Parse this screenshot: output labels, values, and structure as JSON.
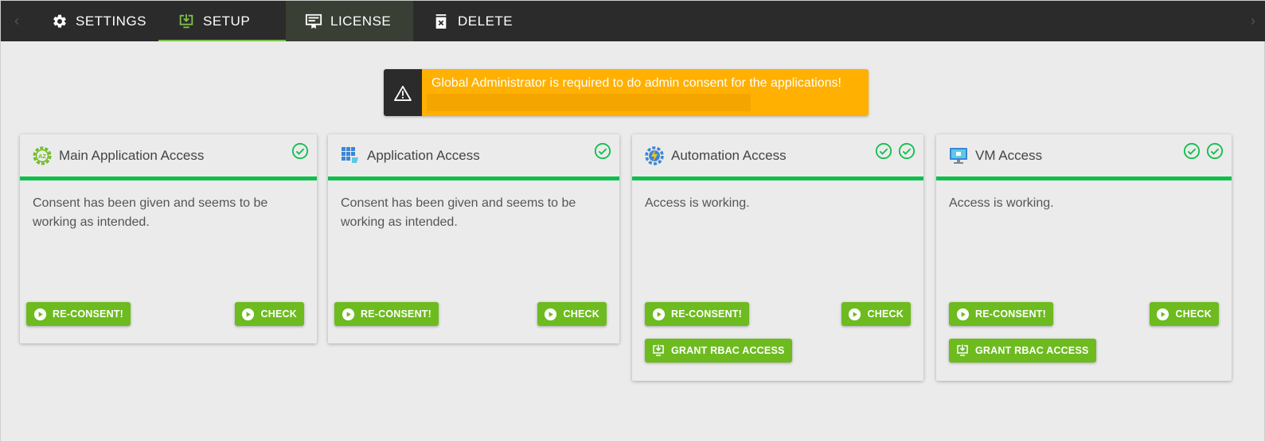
{
  "tabs": [
    {
      "label": "SETTINGS",
      "icon": "gear-icon"
    },
    {
      "label": "SETUP",
      "icon": "download-icon"
    },
    {
      "label": "LICENSE",
      "icon": "certificate-icon"
    },
    {
      "label": "DELETE",
      "icon": "trash-icon"
    }
  ],
  "alert": {
    "message": "Global Administrator is required to do admin consent for the applications!",
    "icon": "warning-icon"
  },
  "cards": [
    {
      "title": "Main Application Access",
      "icon": "azure-gear-icon",
      "text": "Consent has been given and seems to be working as intended.",
      "checks": 1,
      "reconsent_label": "RE-CONSENT!",
      "check_label": "CHECK"
    },
    {
      "title": "Application Access",
      "icon": "app-grid-icon",
      "text": "Consent has been given and seems to be working as intended.",
      "checks": 1,
      "reconsent_label": "RE-CONSENT!",
      "check_label": "CHECK"
    },
    {
      "title": "Automation Access",
      "icon": "automation-gear-icon",
      "text": "Access is working.",
      "checks": 2,
      "reconsent_label": "RE-CONSENT!",
      "check_label": "CHECK",
      "grant_label": "GRANT RBAC ACCESS"
    },
    {
      "title": "VM Access",
      "icon": "vm-monitor-icon",
      "text": "Access is working.",
      "checks": 2,
      "reconsent_label": "RE-CONSENT!",
      "check_label": "CHECK",
      "grant_label": "GRANT RBAC ACCESS"
    }
  ],
  "colors": {
    "topbar": "#2b2b2b",
    "accent_green": "#6dbb1f",
    "status_green": "#0fbf4c",
    "alert_yellow": "#ffb000"
  }
}
